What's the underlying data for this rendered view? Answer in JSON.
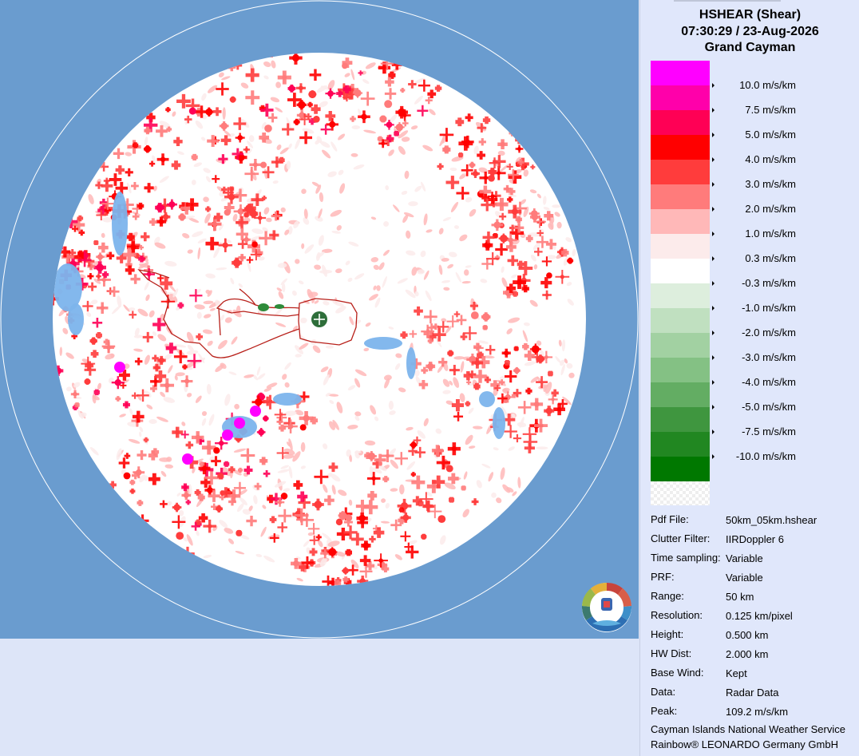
{
  "header": {
    "product": "HSHEAR (Shear)",
    "datetime": "07:30:29 / 23-Aug-2026",
    "site": "Grand Cayman"
  },
  "legend": [
    {
      "label": "10.0 m/s/km",
      "color": "#ff00ff"
    },
    {
      "label": "7.5 m/s/km",
      "color": "#ff00aa"
    },
    {
      "label": "5.0 m/s/km",
      "color": "#ff0055"
    },
    {
      "label": "4.0 m/s/km",
      "color": "#ff0000"
    },
    {
      "label": "3.0 m/s/km",
      "color": "#ff3c3c"
    },
    {
      "label": "2.0 m/s/km",
      "color": "#ff7b7b"
    },
    {
      "label": "1.0 m/s/km",
      "color": "#ffb8b8"
    },
    {
      "label": "0.3 m/s/km",
      "color": "#fcebeb"
    },
    {
      "label": "-0.3 m/s/km",
      "color": "#ffffff"
    },
    {
      "label": "-1.0 m/s/km",
      "color": "#ddeedd"
    },
    {
      "label": "-2.0 m/s/km",
      "color": "#c0e0c0"
    },
    {
      "label": "-3.0 m/s/km",
      "color": "#a2d1a2"
    },
    {
      "label": "-4.0 m/s/km",
      "color": "#84c184"
    },
    {
      "label": "-5.0 m/s/km",
      "color": "#63ad63"
    },
    {
      "label": "-7.5 m/s/km",
      "color": "#3f963f"
    },
    {
      "label": "-10.0 m/s/km",
      "color": "#218721"
    },
    {
      "label": "",
      "color": "#007800"
    }
  ],
  "info": [
    {
      "key": "Pdf File:",
      "value": "50km_05km.hshear"
    },
    {
      "key": "Clutter Filter:",
      "value": "IIRDoppler 6"
    },
    {
      "key": "Time sampling:",
      "value": "Variable"
    },
    {
      "key": "PRF:",
      "value": "Variable"
    },
    {
      "key": "Range:",
      "value": "50 km"
    },
    {
      "key": "Resolution:",
      "value": "0.125 km/pixel"
    },
    {
      "key": "Height:",
      "value": "0.500 km"
    },
    {
      "key": "HW Dist:",
      "value": "2.000 km"
    },
    {
      "key": "Base Wind:",
      "value": "Kept"
    },
    {
      "key": "Data:",
      "value": "Radar Data"
    },
    {
      "key": "Peak:",
      "value": "109.2 m/s/km"
    }
  ],
  "footer": {
    "line1": "Cayman Islands National Weather Service",
    "line2": "Rainbow® LEONARDO Germany GmbH"
  },
  "map": {
    "ocean_color": "#6a9ccf",
    "no_data_color": "#7cb4ec",
    "coastline_color": "#b8201a",
    "radar_marker_color": "#2e6e3a",
    "logo_icon": "cayman-weather-service-logo"
  }
}
